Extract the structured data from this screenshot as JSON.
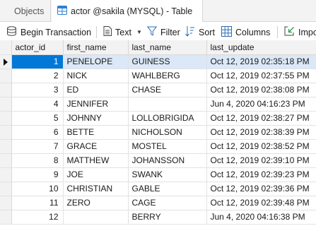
{
  "tabs": {
    "objects_label": "Objects",
    "table_label": "actor @sakila (MYSQL) - Table"
  },
  "toolbar": {
    "begin_transaction": "Begin Transaction",
    "text": "Text",
    "filter": "Filter",
    "sort": "Sort",
    "columns": "Columns",
    "import": "Impo"
  },
  "grid": {
    "headers": [
      "actor_id",
      "first_name",
      "last_name",
      "last_update"
    ],
    "selected_row": 0,
    "rows": [
      {
        "actor_id": "1",
        "first_name": "PENELOPE",
        "last_name": "GUINESS",
        "last_update": "Oct 12, 2019 02:35:18 PM"
      },
      {
        "actor_id": "2",
        "first_name": "NICK",
        "last_name": "WAHLBERG",
        "last_update": "Oct 12, 2019 02:37:55 PM"
      },
      {
        "actor_id": "3",
        "first_name": "ED",
        "last_name": "CHASE",
        "last_update": "Oct 12, 2019 02:38:08 PM"
      },
      {
        "actor_id": "4",
        "first_name": "JENNIFER",
        "last_name": "",
        "last_update": "Jun 4, 2020 04:16:23 PM"
      },
      {
        "actor_id": "5",
        "first_name": "JOHNNY",
        "last_name": "LOLLOBRIGIDA",
        "last_update": "Oct 12, 2019 02:38:27 PM"
      },
      {
        "actor_id": "6",
        "first_name": "BETTE",
        "last_name": "NICHOLSON",
        "last_update": "Oct 12, 2019 02:38:39 PM"
      },
      {
        "actor_id": "7",
        "first_name": "GRACE",
        "last_name": "MOSTEL",
        "last_update": "Oct 12, 2019 02:38:52 PM"
      },
      {
        "actor_id": "8",
        "first_name": "MATTHEW",
        "last_name": "JOHANSSON",
        "last_update": "Oct 12, 2019 02:39:10 PM"
      },
      {
        "actor_id": "9",
        "first_name": "JOE",
        "last_name": "SWANK",
        "last_update": "Oct 12, 2019 02:39:23 PM"
      },
      {
        "actor_id": "10",
        "first_name": "CHRISTIAN",
        "last_name": "GABLE",
        "last_update": "Oct 12, 2019 02:39:36 PM"
      },
      {
        "actor_id": "11",
        "first_name": "ZERO",
        "last_name": "CAGE",
        "last_update": "Oct 12, 2019 02:39:48 PM"
      },
      {
        "actor_id": "12",
        "first_name": "",
        "last_name": "BERRY",
        "last_update": "Jun 4, 2020 04:16:38 PM"
      }
    ]
  },
  "colors": {
    "selected_id_bg": "#0078d7",
    "selected_row_bg": "#dbe8f7",
    "toolbar_icon": "#2b6cb0"
  },
  "icons": [
    "table-icon",
    "begin-transaction-icon",
    "text-icon",
    "filter-icon",
    "sort-icon",
    "columns-icon",
    "import-icon",
    "row-selector-arrow-icon"
  ]
}
